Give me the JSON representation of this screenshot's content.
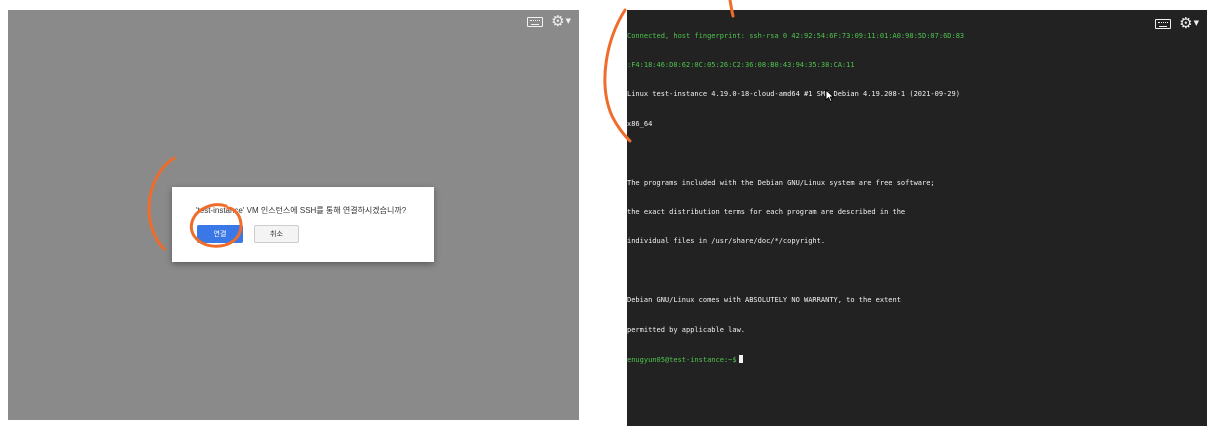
{
  "left_window": {
    "dialog": {
      "message": "'test-instance' VM 인스턴스에 SSH를 통해 연결하시겠습니까?",
      "connect_label": "연결",
      "cancel_label": "취소"
    },
    "toolbar": {
      "keyboard_icon": "keyboard-icon",
      "settings_icon": "gear-icon"
    }
  },
  "right_window": {
    "toolbar": {
      "keyboard_icon": "keyboard-icon",
      "settings_icon": "gear-icon"
    },
    "terminal": {
      "lines": [
        {
          "text": "Connected, host fingerprint: ssh-rsa 0 42:92:54:6F:73:09:11:01:A0:98:5D:07:6D:83",
          "color": "green"
        },
        {
          "text": ":F4:18:46:D8:62:0C:05:26:C2:36:08:B0:43:94:35:38:CA:11",
          "color": "green"
        },
        {
          "text": "Linux test-instance 4.19.0-18-cloud-amd64 #1 SMP Debian 4.19.208-1 (2021-09-29)",
          "color": "white"
        },
        {
          "text": "x86_64",
          "color": "white"
        },
        {
          "text": "",
          "color": "white"
        },
        {
          "text": "The programs included with the Debian GNU/Linux system are free software;",
          "color": "white"
        },
        {
          "text": "the exact distribution terms for each program are described in the",
          "color": "white"
        },
        {
          "text": "individual files in /usr/share/doc/*/copyright.",
          "color": "white"
        },
        {
          "text": "",
          "color": "white"
        },
        {
          "text": "Debian GNU/Linux comes with ABSOLUTELY NO WARRANTY, to the extent",
          "color": "white"
        },
        {
          "text": "permitted by applicable law.",
          "color": "white"
        }
      ],
      "prompt": "enugyun05@test-instance:~$"
    }
  },
  "colors": {
    "left_background": "#8a8a8a",
    "terminal_background": "#222222",
    "terminal_text": "#f2f2f2",
    "terminal_green": "#4fc54f",
    "connect_button": "#3b78e7",
    "annotation_stroke": "#ef6c2a"
  }
}
